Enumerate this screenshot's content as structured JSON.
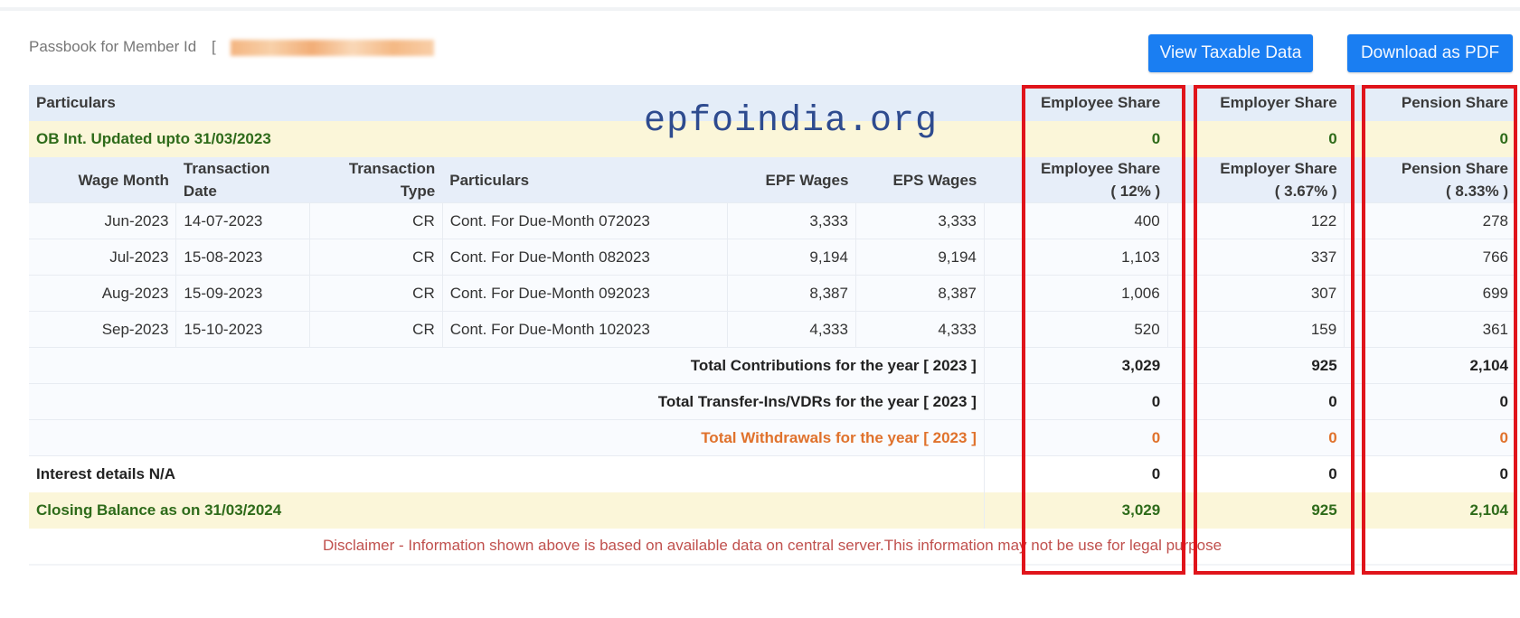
{
  "header": {
    "member_label": "Passbook for Member Id",
    "bracket": "[",
    "member_id_redacted": true
  },
  "buttons": {
    "view_taxable": "View Taxable Data",
    "download_pdf": "Download as PDF"
  },
  "watermark": "epfoindia.org",
  "table": {
    "head": {
      "particulars": "Particulars",
      "employee_share": "Employee Share",
      "employer_share": "Employer Share",
      "pension_share": "Pension Share"
    },
    "opening": {
      "label": "OB Int. Updated upto 31/03/2023",
      "employee": "0",
      "employer": "0",
      "pension": "0"
    },
    "columns": {
      "wage_month": "Wage Month",
      "txn_date_1": "Transaction",
      "txn_date_2": "Date",
      "txn_type_1": "Transaction",
      "txn_type_2": "Type",
      "particulars": "Particulars",
      "epf_wages": "EPF Wages",
      "eps_wages": "EPS Wages",
      "employee_1": "Employee Share",
      "employee_2": "( 12% )",
      "employer_1": "Employer Share",
      "employer_2": "( 3.67% )",
      "pension_1": "Pension Share",
      "pension_2": "( 8.33% )"
    },
    "rows": [
      {
        "wage_month": "Jun-2023",
        "date": "14-07-2023",
        "type": "CR",
        "particulars": "Cont. For Due-Month 072023",
        "epf": "3,333",
        "eps": "3,333",
        "employee": "400",
        "employer": "122",
        "pension": "278"
      },
      {
        "wage_month": "Jul-2023",
        "date": "15-08-2023",
        "type": "CR",
        "particulars": "Cont. For Due-Month 082023",
        "epf": "9,194",
        "eps": "9,194",
        "employee": "1,103",
        "employer": "337",
        "pension": "766"
      },
      {
        "wage_month": "Aug-2023",
        "date": "15-09-2023",
        "type": "CR",
        "particulars": "Cont. For Due-Month 092023",
        "epf": "8,387",
        "eps": "8,387",
        "employee": "1,006",
        "employer": "307",
        "pension": "699"
      },
      {
        "wage_month": "Sep-2023",
        "date": "15-10-2023",
        "type": "CR",
        "particulars": "Cont. For Due-Month 102023",
        "epf": "4,333",
        "eps": "4,333",
        "employee": "520",
        "employer": "159",
        "pension": "361"
      }
    ],
    "totals": [
      {
        "label": "Total Contributions for the year [ 2023 ]",
        "employee": "3,029",
        "employer": "925",
        "pension": "2,104"
      },
      {
        "label": "Total Transfer-Ins/VDRs for the year [ 2023 ]",
        "employee": "0",
        "employer": "0",
        "pension": "0"
      },
      {
        "label": "Total Withdrawals for the year [ 2023 ]",
        "employee": "0",
        "employer": "0",
        "pension": "0"
      }
    ],
    "interest": {
      "label": "Interest details N/A",
      "employee": "0",
      "employer": "0",
      "pension": "0"
    },
    "closing": {
      "label": "Closing Balance as on 31/03/2024",
      "employee": "3,029",
      "employer": "925",
      "pension": "2,104"
    },
    "disclaimer": "Disclaimer - Information shown above is based on available data on central server.This information may not be use for legal purpose"
  },
  "colors": {
    "button": "#1a7ef2",
    "highlight_box": "#e0141b",
    "balance_text": "#2e6b1a",
    "withdrawal_text": "#e0722c",
    "disclaimer_text": "#c0504d"
  }
}
